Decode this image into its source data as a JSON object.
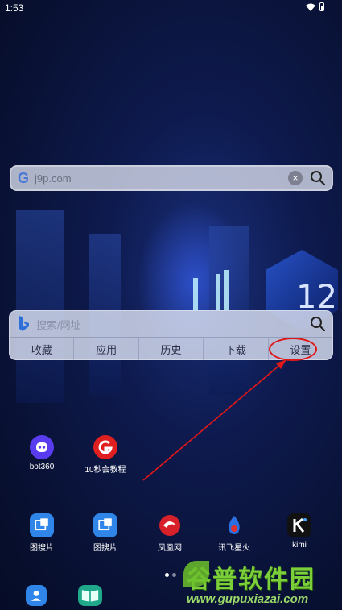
{
  "status_bar": {
    "time": "1:53"
  },
  "google_search": {
    "url_text": "j9p.com",
    "clear_symbol": "×"
  },
  "bing_widget": {
    "placeholder": "搜索/网址",
    "tabs": [
      "收藏",
      "应用",
      "历史",
      "下载",
      "设置"
    ]
  },
  "wallpaper": {
    "number_text": "12"
  },
  "apps_row1": [
    {
      "label": "bot360",
      "icon": "bot360-icon",
      "color": "#5a3cf0"
    },
    {
      "label": "10秒会教程",
      "icon": "g-logo-icon",
      "color": "#e02020"
    }
  ],
  "dock_apps": [
    {
      "label": "图搜片",
      "icon": "image-search-icon",
      "color": "#2f86e8"
    },
    {
      "label": "图搜片",
      "icon": "image-search-icon",
      "color": "#2f86e8"
    },
    {
      "label": "凤凰网",
      "icon": "phoenix-icon",
      "color": "#d8202a"
    },
    {
      "label": "讯飞星火",
      "icon": "spark-icon",
      "color": "#2b6fe0"
    },
    {
      "label": "kimi",
      "icon": "kimi-icon",
      "color": "#111111"
    }
  ],
  "bottom_apps": [
    {
      "icon": "contacts-icon",
      "color": "#2f86e8"
    },
    {
      "icon": "book-icon",
      "color": "#1fa88a"
    }
  ],
  "watermark": {
    "line1": "谷普软件园",
    "line2": "www.gupuxiazai.com"
  },
  "colors": {
    "highlight": "#e01818"
  }
}
